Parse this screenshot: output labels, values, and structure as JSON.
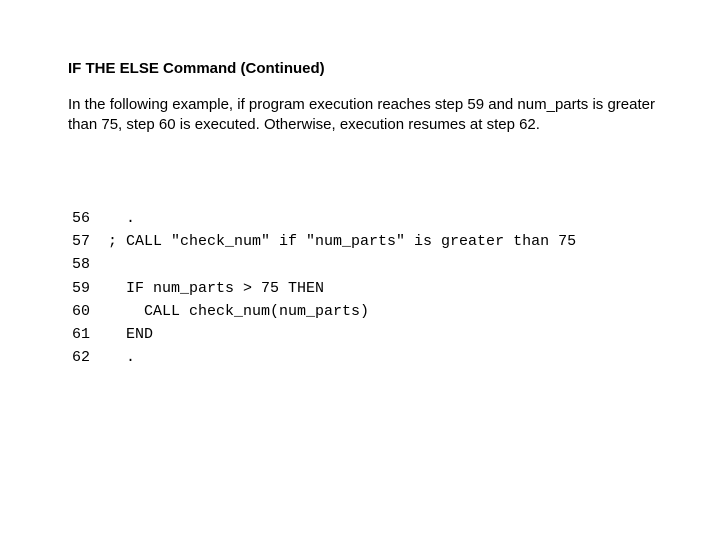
{
  "heading": "IF THE ELSE  Command  (Continued)",
  "paragraph": "In the following example, if program execution reaches step 59 and num_parts is greater than 75, step 60 is executed.  Otherwise, execution resumes at step 62.",
  "code": {
    "lines": [
      {
        "num": "56",
        "text": "  ."
      },
      {
        "num": "57",
        "text": "; CALL \"check_num\" if \"num_parts\" is greater than 75"
      },
      {
        "num": "58",
        "text": ""
      },
      {
        "num": "59",
        "text": "  IF num_parts > 75 THEN"
      },
      {
        "num": "60",
        "text": "    CALL check_num(num_parts)"
      },
      {
        "num": "61",
        "text": "  END"
      },
      {
        "num": "62",
        "text": "  ."
      }
    ]
  }
}
